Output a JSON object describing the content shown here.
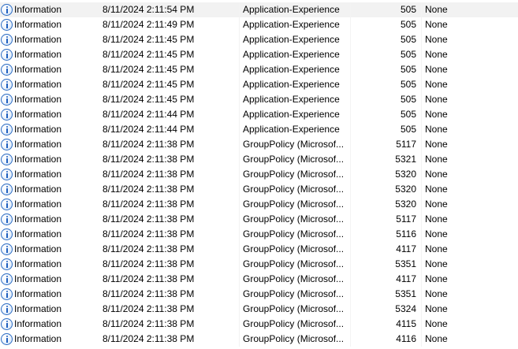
{
  "event_list": {
    "rows": [
      {
        "level": "Information",
        "date_time": "8/11/2024 2:11:54 PM",
        "source": "Application-Experience",
        "event_id": "505",
        "task_category": "None"
      },
      {
        "level": "Information",
        "date_time": "8/11/2024 2:11:49 PM",
        "source": "Application-Experience",
        "event_id": "505",
        "task_category": "None"
      },
      {
        "level": "Information",
        "date_time": "8/11/2024 2:11:45 PM",
        "source": "Application-Experience",
        "event_id": "505",
        "task_category": "None"
      },
      {
        "level": "Information",
        "date_time": "8/11/2024 2:11:45 PM",
        "source": "Application-Experience",
        "event_id": "505",
        "task_category": "None"
      },
      {
        "level": "Information",
        "date_time": "8/11/2024 2:11:45 PM",
        "source": "Application-Experience",
        "event_id": "505",
        "task_category": "None"
      },
      {
        "level": "Information",
        "date_time": "8/11/2024 2:11:45 PM",
        "source": "Application-Experience",
        "event_id": "505",
        "task_category": "None"
      },
      {
        "level": "Information",
        "date_time": "8/11/2024 2:11:45 PM",
        "source": "Application-Experience",
        "event_id": "505",
        "task_category": "None"
      },
      {
        "level": "Information",
        "date_time": "8/11/2024 2:11:44 PM",
        "source": "Application-Experience",
        "event_id": "505",
        "task_category": "None"
      },
      {
        "level": "Information",
        "date_time": "8/11/2024 2:11:44 PM",
        "source": "Application-Experience",
        "event_id": "505",
        "task_category": "None"
      },
      {
        "level": "Information",
        "date_time": "8/11/2024 2:11:38 PM",
        "source": "GroupPolicy (Microsof...",
        "event_id": "5117",
        "task_category": "None"
      },
      {
        "level": "Information",
        "date_time": "8/11/2024 2:11:38 PM",
        "source": "GroupPolicy (Microsof...",
        "event_id": "5321",
        "task_category": "None"
      },
      {
        "level": "Information",
        "date_time": "8/11/2024 2:11:38 PM",
        "source": "GroupPolicy (Microsof...",
        "event_id": "5320",
        "task_category": "None"
      },
      {
        "level": "Information",
        "date_time": "8/11/2024 2:11:38 PM",
        "source": "GroupPolicy (Microsof...",
        "event_id": "5320",
        "task_category": "None"
      },
      {
        "level": "Information",
        "date_time": "8/11/2024 2:11:38 PM",
        "source": "GroupPolicy (Microsof...",
        "event_id": "5320",
        "task_category": "None"
      },
      {
        "level": "Information",
        "date_time": "8/11/2024 2:11:38 PM",
        "source": "GroupPolicy (Microsof...",
        "event_id": "5117",
        "task_category": "None"
      },
      {
        "level": "Information",
        "date_time": "8/11/2024 2:11:38 PM",
        "source": "GroupPolicy (Microsof...",
        "event_id": "5116",
        "task_category": "None"
      },
      {
        "level": "Information",
        "date_time": "8/11/2024 2:11:38 PM",
        "source": "GroupPolicy (Microsof...",
        "event_id": "4117",
        "task_category": "None"
      },
      {
        "level": "Information",
        "date_time": "8/11/2024 2:11:38 PM",
        "source": "GroupPolicy (Microsof...",
        "event_id": "5351",
        "task_category": "None"
      },
      {
        "level": "Information",
        "date_time": "8/11/2024 2:11:38 PM",
        "source": "GroupPolicy (Microsof...",
        "event_id": "4117",
        "task_category": "None"
      },
      {
        "level": "Information",
        "date_time": "8/11/2024 2:11:38 PM",
        "source": "GroupPolicy (Microsof...",
        "event_id": "5351",
        "task_category": "None"
      },
      {
        "level": "Information",
        "date_time": "8/11/2024 2:11:38 PM",
        "source": "GroupPolicy (Microsof...",
        "event_id": "5324",
        "task_category": "None"
      },
      {
        "level": "Information",
        "date_time": "8/11/2024 2:11:38 PM",
        "source": "GroupPolicy (Microsof...",
        "event_id": "4115",
        "task_category": "None"
      },
      {
        "level": "Information",
        "date_time": "8/11/2024 2:11:38 PM",
        "source": "GroupPolicy (Microsof...",
        "event_id": "4116",
        "task_category": "None"
      }
    ],
    "level_icon": "information-icon",
    "selected_row_index": 0
  }
}
